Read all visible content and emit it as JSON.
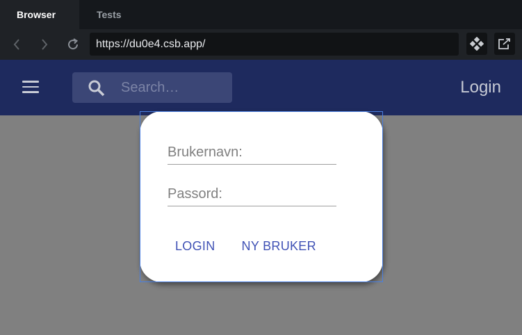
{
  "browser": {
    "tabs": [
      {
        "label": "Browser",
        "active": true
      },
      {
        "label": "Tests",
        "active": false
      }
    ],
    "url": "https://du0e4.csb.app/"
  },
  "appbar": {
    "search_placeholder": "Search…",
    "login_label": "Login",
    "color": "#1e2a5e"
  },
  "dialog": {
    "username_label": "Brukernavn:",
    "password_label": "Passord:",
    "login_button": "LOGIN",
    "new_user_button": "NY BRUKER",
    "accent": "#3f51b5"
  }
}
